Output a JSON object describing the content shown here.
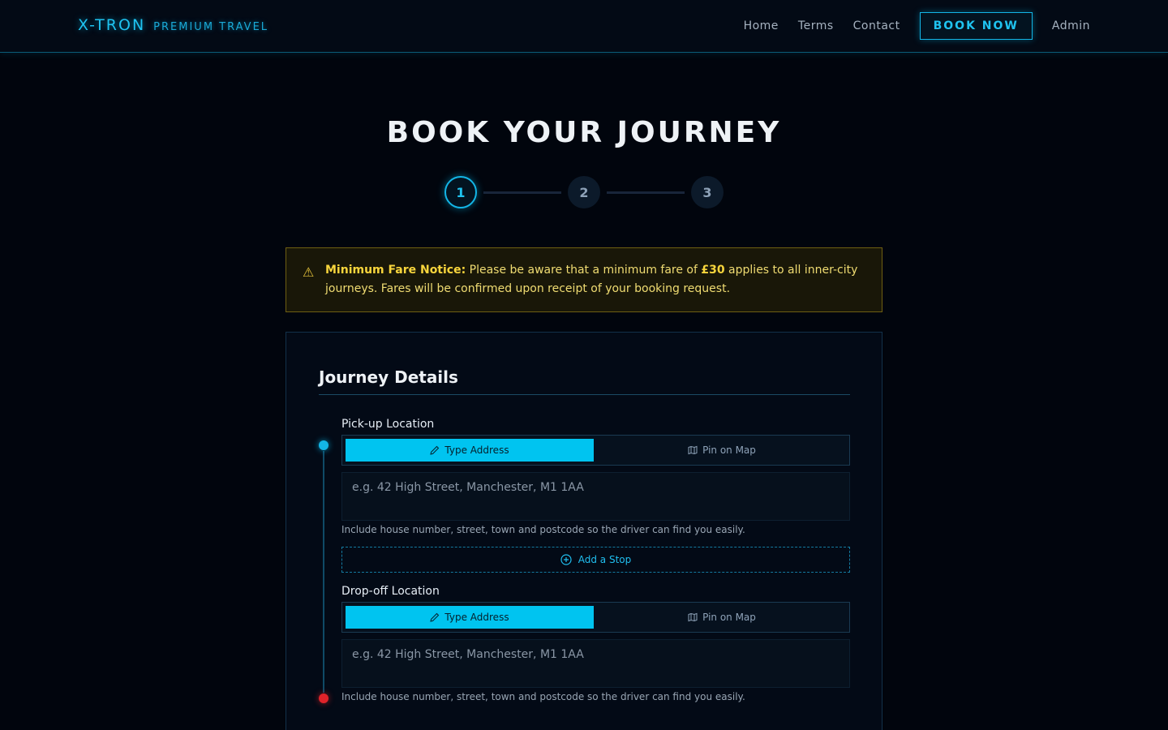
{
  "header": {
    "brand_name": "X-TRON",
    "brand_tag": "PREMIUM TRAVEL",
    "nav": [
      "Home",
      "Terms",
      "Contact"
    ],
    "book_now": "BOOK NOW",
    "admin": "Admin"
  },
  "page": {
    "title": "BOOK YOUR JOURNEY"
  },
  "stepper": {
    "steps": [
      "1",
      "2",
      "3"
    ],
    "active_step": 1
  },
  "notice": {
    "icon": "warning-icon",
    "heading": "Minimum Fare Notice:",
    "text_before": " Please be aware that a minimum fare of ",
    "amount": "£30",
    "text_after": " applies to all inner-city journeys. Fares will be confirmed upon receipt of your booking request."
  },
  "journey": {
    "title": "Journey Details",
    "pickup": {
      "label": "Pick-up Location",
      "type_address": "Type Address",
      "pin_on_map": "Pin on Map",
      "placeholder": "e.g. 42 High Street, Manchester, M1 1AA",
      "value": "",
      "helper": "Include house number, street, town and postcode so the driver can find you easily."
    },
    "add_stop": "Add a Stop",
    "dropoff": {
      "label": "Drop-off Location",
      "type_address": "Type Address",
      "pin_on_map": "Pin on Map",
      "placeholder": "e.g. 42 High Street, Manchester, M1 1AA",
      "value": "",
      "helper": "Include house number, street, town and postcode so the driver can find you easily."
    }
  },
  "colors": {
    "accent": "#00c4f0",
    "background": "#01050d",
    "notice_text": "#f0dc72",
    "pickup_dot": "#13b5e6",
    "dropoff_dot": "#e0232a"
  }
}
